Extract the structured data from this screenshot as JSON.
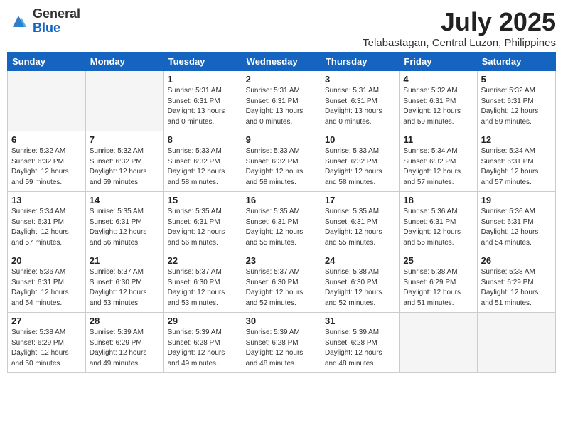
{
  "header": {
    "logo_general": "General",
    "logo_blue": "Blue",
    "month_title": "July 2025",
    "location": "Telabastagan, Central Luzon, Philippines"
  },
  "days_of_week": [
    "Sunday",
    "Monday",
    "Tuesday",
    "Wednesday",
    "Thursday",
    "Friday",
    "Saturday"
  ],
  "weeks": [
    [
      {
        "day": "",
        "info": ""
      },
      {
        "day": "",
        "info": ""
      },
      {
        "day": "1",
        "info": "Sunrise: 5:31 AM\nSunset: 6:31 PM\nDaylight: 13 hours\nand 0 minutes."
      },
      {
        "day": "2",
        "info": "Sunrise: 5:31 AM\nSunset: 6:31 PM\nDaylight: 13 hours\nand 0 minutes."
      },
      {
        "day": "3",
        "info": "Sunrise: 5:31 AM\nSunset: 6:31 PM\nDaylight: 13 hours\nand 0 minutes."
      },
      {
        "day": "4",
        "info": "Sunrise: 5:32 AM\nSunset: 6:31 PM\nDaylight: 12 hours\nand 59 minutes."
      },
      {
        "day": "5",
        "info": "Sunrise: 5:32 AM\nSunset: 6:31 PM\nDaylight: 12 hours\nand 59 minutes."
      }
    ],
    [
      {
        "day": "6",
        "info": "Sunrise: 5:32 AM\nSunset: 6:32 PM\nDaylight: 12 hours\nand 59 minutes."
      },
      {
        "day": "7",
        "info": "Sunrise: 5:32 AM\nSunset: 6:32 PM\nDaylight: 12 hours\nand 59 minutes."
      },
      {
        "day": "8",
        "info": "Sunrise: 5:33 AM\nSunset: 6:32 PM\nDaylight: 12 hours\nand 58 minutes."
      },
      {
        "day": "9",
        "info": "Sunrise: 5:33 AM\nSunset: 6:32 PM\nDaylight: 12 hours\nand 58 minutes."
      },
      {
        "day": "10",
        "info": "Sunrise: 5:33 AM\nSunset: 6:32 PM\nDaylight: 12 hours\nand 58 minutes."
      },
      {
        "day": "11",
        "info": "Sunrise: 5:34 AM\nSunset: 6:32 PM\nDaylight: 12 hours\nand 57 minutes."
      },
      {
        "day": "12",
        "info": "Sunrise: 5:34 AM\nSunset: 6:31 PM\nDaylight: 12 hours\nand 57 minutes."
      }
    ],
    [
      {
        "day": "13",
        "info": "Sunrise: 5:34 AM\nSunset: 6:31 PM\nDaylight: 12 hours\nand 57 minutes."
      },
      {
        "day": "14",
        "info": "Sunrise: 5:35 AM\nSunset: 6:31 PM\nDaylight: 12 hours\nand 56 minutes."
      },
      {
        "day": "15",
        "info": "Sunrise: 5:35 AM\nSunset: 6:31 PM\nDaylight: 12 hours\nand 56 minutes."
      },
      {
        "day": "16",
        "info": "Sunrise: 5:35 AM\nSunset: 6:31 PM\nDaylight: 12 hours\nand 55 minutes."
      },
      {
        "day": "17",
        "info": "Sunrise: 5:35 AM\nSunset: 6:31 PM\nDaylight: 12 hours\nand 55 minutes."
      },
      {
        "day": "18",
        "info": "Sunrise: 5:36 AM\nSunset: 6:31 PM\nDaylight: 12 hours\nand 55 minutes."
      },
      {
        "day": "19",
        "info": "Sunrise: 5:36 AM\nSunset: 6:31 PM\nDaylight: 12 hours\nand 54 minutes."
      }
    ],
    [
      {
        "day": "20",
        "info": "Sunrise: 5:36 AM\nSunset: 6:31 PM\nDaylight: 12 hours\nand 54 minutes."
      },
      {
        "day": "21",
        "info": "Sunrise: 5:37 AM\nSunset: 6:30 PM\nDaylight: 12 hours\nand 53 minutes."
      },
      {
        "day": "22",
        "info": "Sunrise: 5:37 AM\nSunset: 6:30 PM\nDaylight: 12 hours\nand 53 minutes."
      },
      {
        "day": "23",
        "info": "Sunrise: 5:37 AM\nSunset: 6:30 PM\nDaylight: 12 hours\nand 52 minutes."
      },
      {
        "day": "24",
        "info": "Sunrise: 5:38 AM\nSunset: 6:30 PM\nDaylight: 12 hours\nand 52 minutes."
      },
      {
        "day": "25",
        "info": "Sunrise: 5:38 AM\nSunset: 6:29 PM\nDaylight: 12 hours\nand 51 minutes."
      },
      {
        "day": "26",
        "info": "Sunrise: 5:38 AM\nSunset: 6:29 PM\nDaylight: 12 hours\nand 51 minutes."
      }
    ],
    [
      {
        "day": "27",
        "info": "Sunrise: 5:38 AM\nSunset: 6:29 PM\nDaylight: 12 hours\nand 50 minutes."
      },
      {
        "day": "28",
        "info": "Sunrise: 5:39 AM\nSunset: 6:29 PM\nDaylight: 12 hours\nand 49 minutes."
      },
      {
        "day": "29",
        "info": "Sunrise: 5:39 AM\nSunset: 6:28 PM\nDaylight: 12 hours\nand 49 minutes."
      },
      {
        "day": "30",
        "info": "Sunrise: 5:39 AM\nSunset: 6:28 PM\nDaylight: 12 hours\nand 48 minutes."
      },
      {
        "day": "31",
        "info": "Sunrise: 5:39 AM\nSunset: 6:28 PM\nDaylight: 12 hours\nand 48 minutes."
      },
      {
        "day": "",
        "info": ""
      },
      {
        "day": "",
        "info": ""
      }
    ]
  ]
}
